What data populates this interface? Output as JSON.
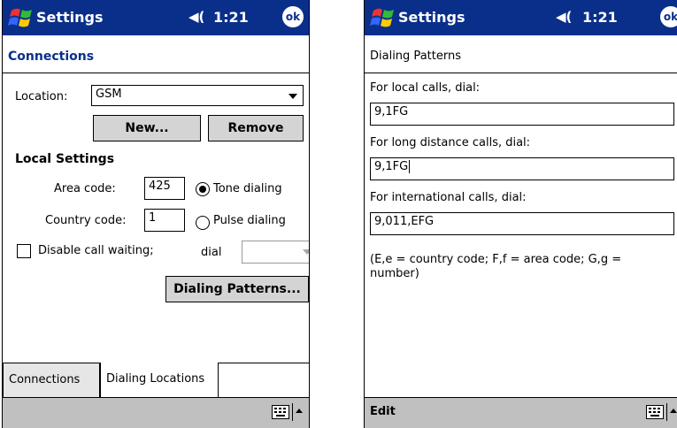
{
  "left": {
    "titlebar": {
      "title": "Settings",
      "speaker": "◀(",
      "time": "1:21",
      "ok": "ok"
    },
    "heading": "Connections",
    "location_label": "Location:",
    "location_value": "GSM",
    "new_button": "New...",
    "remove_button": "Remove",
    "local_settings_heading": "Local Settings",
    "area_code_label": "Area code:",
    "area_code_value": "425",
    "tone_label": "Tone dialing",
    "country_code_label": "Country code:",
    "country_code_value": "1",
    "pulse_label": "Pulse dialing",
    "call_waiting_label": "Disable call waiting;",
    "dial_label": "dial",
    "dialing_patterns_button": "Dialing Patterns...",
    "tabs": [
      {
        "label": "Connections"
      },
      {
        "label": "Dialing Locations"
      }
    ]
  },
  "right": {
    "titlebar": {
      "title": "Settings",
      "speaker": "◀(",
      "time": "1:21",
      "ok": "ok"
    },
    "heading": "Dialing Patterns",
    "local_label": "For local calls, dial:",
    "local_value": "9,1FG",
    "long_label": "For long distance calls, dial:",
    "long_value": "9,1FG",
    "intl_label": "For international calls, dial:",
    "intl_value": "9,011,EFG",
    "help_text": "(E,e = country code; F,f = area code; G,g = number)",
    "menu_edit": "Edit"
  },
  "colors": {
    "titlebar": "#0a2f8a",
    "menubar": "#c0c0c0",
    "button": "#d4d4d4"
  }
}
